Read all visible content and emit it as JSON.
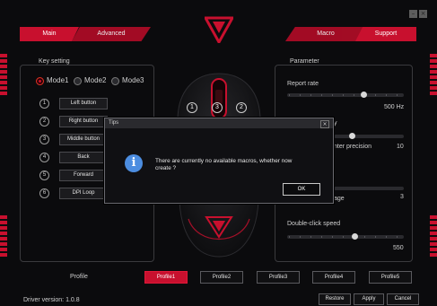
{
  "window": {
    "minimize_glyph": "–",
    "close_glyph": "×"
  },
  "tabs": [
    {
      "label": "Main"
    },
    {
      "label": "Advanced"
    },
    {
      "label": "Macro"
    },
    {
      "label": "Support"
    }
  ],
  "key_setting": {
    "title": "Key setting",
    "modes": [
      {
        "label": "Mode1",
        "selected": true
      },
      {
        "label": "Mode2",
        "selected": false
      },
      {
        "label": "Mode3",
        "selected": false
      }
    ],
    "keys": [
      {
        "num": "1",
        "label": "Left button"
      },
      {
        "num": "2",
        "label": "Right button"
      },
      {
        "num": "3",
        "label": "Middle button"
      },
      {
        "num": "4",
        "label": "Back"
      },
      {
        "num": "5",
        "label": "Forward"
      },
      {
        "num": "6",
        "label": "DPI Loop"
      }
    ]
  },
  "mouse_callouts": [
    "1",
    "3",
    "2"
  ],
  "parameter": {
    "title": "Parameter",
    "report_rate": {
      "label": "Report rate",
      "value": "500 Hz",
      "level": 0.78
    },
    "pointer_label_partial": "y",
    "pointer_precision": {
      "label": "nter precision",
      "value": "10",
      "level": 0.62
    },
    "scroll_partial": {
      "label": "age",
      "value": "3"
    },
    "double_click": {
      "label": "Double-click speed",
      "value": "550",
      "level": 0.6
    }
  },
  "dialog": {
    "title": "Tips",
    "close_glyph": "×",
    "message_line1": "There are currently no available macros, whether now",
    "message_line2": "create ?",
    "ok_label": "OK",
    "icon_glyph": "i"
  },
  "profiles": {
    "label": "Profile",
    "items": [
      {
        "label": "Profile1",
        "active": true
      },
      {
        "label": "Profile2",
        "active": false
      },
      {
        "label": "Profile3",
        "active": false
      },
      {
        "label": "Profile4",
        "active": false
      },
      {
        "label": "Profile5",
        "active": false
      }
    ]
  },
  "footer": {
    "driver_version": "Driver version:  1.0.8",
    "restore_label": "Restore",
    "apply_label": "Apply",
    "cancel_label": "Cancel"
  },
  "colors": {
    "accent": "#c8102e",
    "background": "#0b0b0d",
    "info_blue": "#4c8de0"
  },
  "icons": [
    "logo-v-icon",
    "info-icon",
    "close-icon",
    "minimize-icon"
  ]
}
